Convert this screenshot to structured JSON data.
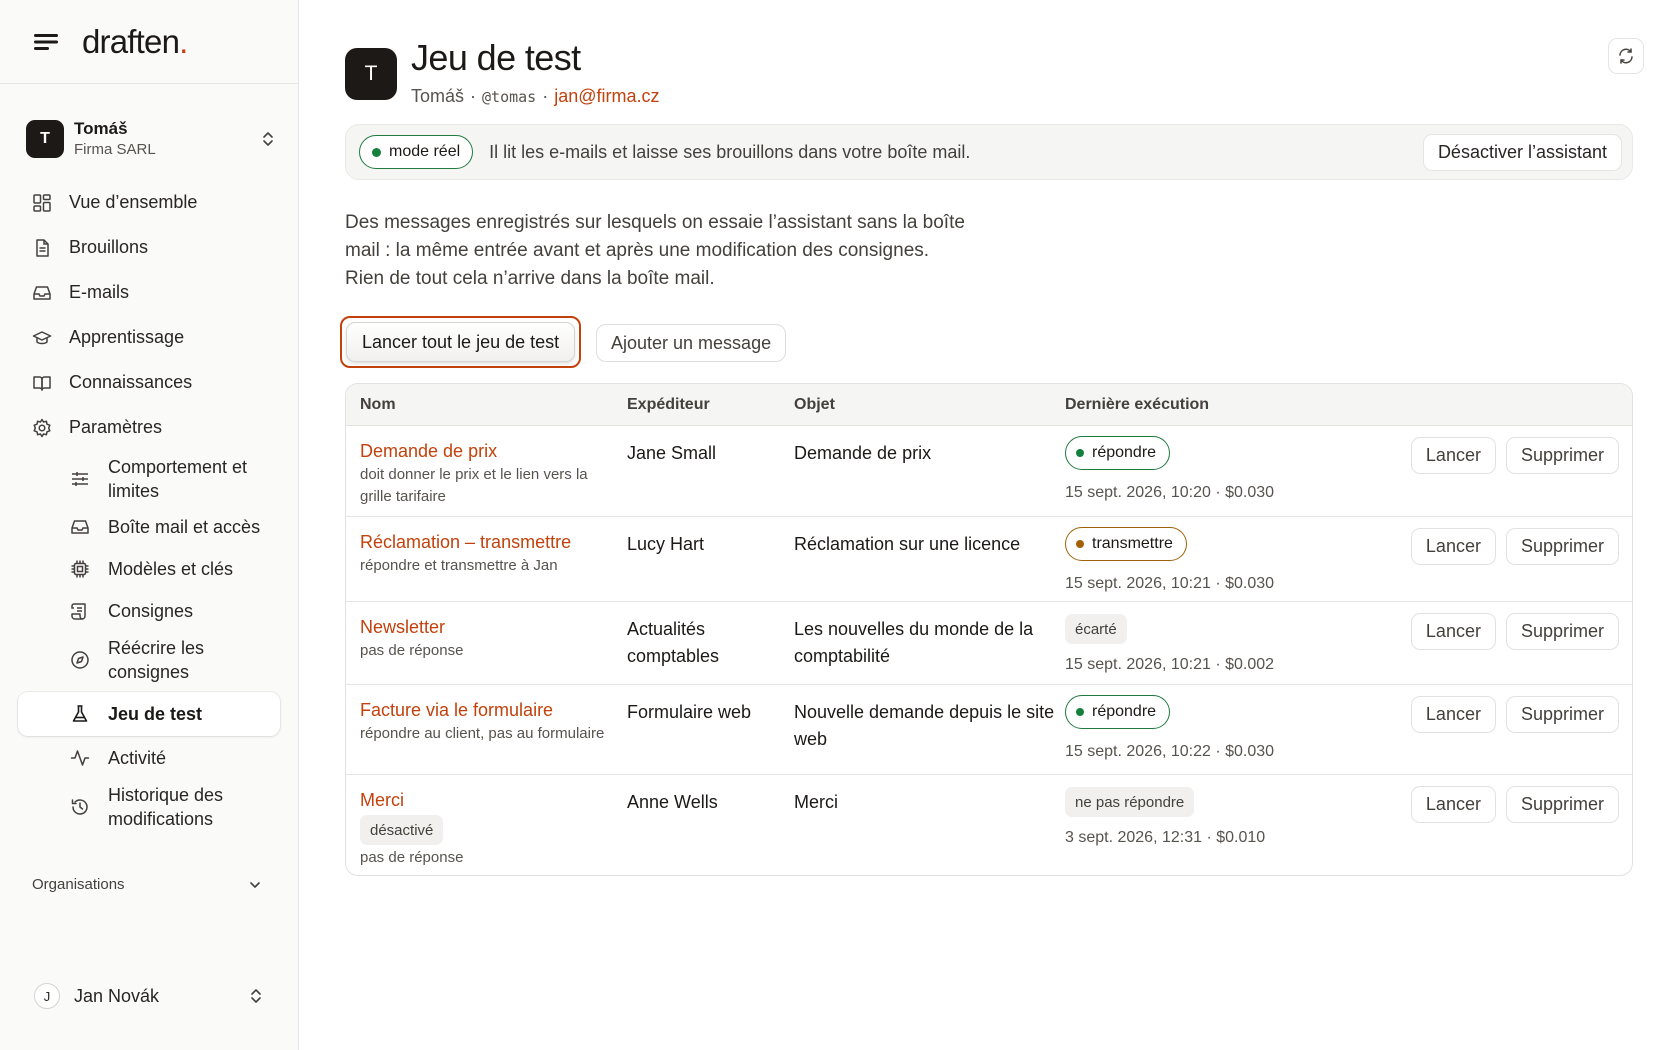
{
  "brand": {
    "name": "draften",
    "dot": ".",
    "menu_icon": "menu-icon",
    "accent_color": "#c2410c"
  },
  "account": {
    "initial": "T",
    "name": "Tomáš",
    "company": "Firma SARL"
  },
  "nav": {
    "overview": "Vue d’ensemble",
    "drafts": "Brouillons",
    "emails": "E-mails",
    "learning": "Apprentissage",
    "knowledge": "Connaissances",
    "settings": "Paramètres"
  },
  "subnav": {
    "behavior": "Comportement et limites",
    "mailbox": "Boîte mail et accès",
    "models": "Modèles et clés",
    "instructions": "Consignes",
    "rewrite": "Réécrire les consignes",
    "testset": "Jeu de test",
    "activity": "Activité",
    "history": "Historique des modifications"
  },
  "organizations_label": "Organisations",
  "user": {
    "initial": "J",
    "name": "Jan Novák"
  },
  "header": {
    "initial": "T",
    "title": "Jeu de test",
    "name": "Tomáš",
    "sep1": "·",
    "handle": "@tomas",
    "sep2": "·",
    "email": "jan@firma.cz"
  },
  "banner": {
    "mode": "mode réel",
    "text": "Il lit les e-mails et laisse ses brouillons dans votre boîte mail.",
    "deactivate": "Désactiver l’assistant",
    "status_color": "#15803d"
  },
  "description": "Des messages enregistrés sur lesquels on essaie l’assistant sans la boîte mail : la même entrée avant et après une modification des consignes. Rien de tout cela n’arrive dans la boîte mail.",
  "actions": {
    "run_all": "Lancer tout le jeu de test",
    "add_message": "Ajouter un message"
  },
  "table": {
    "headers": {
      "name": "Nom",
      "sender": "Expéditeur",
      "subject": "Objet",
      "last_run": "Dernière exécution"
    },
    "run_label": "Lancer",
    "delete_label": "Supprimer",
    "rows": [
      {
        "name": "Demande de prix",
        "note": "doit donner le prix et le lien vers la grille tarifaire",
        "sender": "Jane Small",
        "subject": "Demande de prix",
        "result": "répondre",
        "meta": "15 sept. 2026, 10:20 · $0.030"
      },
      {
        "name": "Réclamation – transmettre",
        "note": "répondre et transmettre à Jan",
        "sender": "Lucy Hart",
        "subject": "Réclamation sur une licence",
        "result": "transmettre",
        "meta": "15 sept. 2026, 10:21 · $0.030"
      },
      {
        "name": "Newsletter",
        "note": "pas de réponse",
        "sender": "Actualités comptables",
        "subject": "Les nouvelles du monde de la comptabilité",
        "result": "écarté",
        "meta": "15 sept. 2026, 10:21 · $0.002"
      },
      {
        "name": "Facture via le formulaire",
        "note": "répondre au client, pas au formulaire",
        "sender": "Formulaire web",
        "subject": "Nouvelle demande depuis le site web",
        "result": "répondre",
        "meta": "15 sept. 2026, 10:22 · $0.030"
      },
      {
        "name": "Merci",
        "disabled_tag": "désactivé",
        "note": "pas de réponse",
        "sender": "Anne Wells",
        "subject": "Merci",
        "result": "ne pas répondre",
        "meta": "3 sept. 2026, 12:31 · $0.010"
      }
    ]
  }
}
